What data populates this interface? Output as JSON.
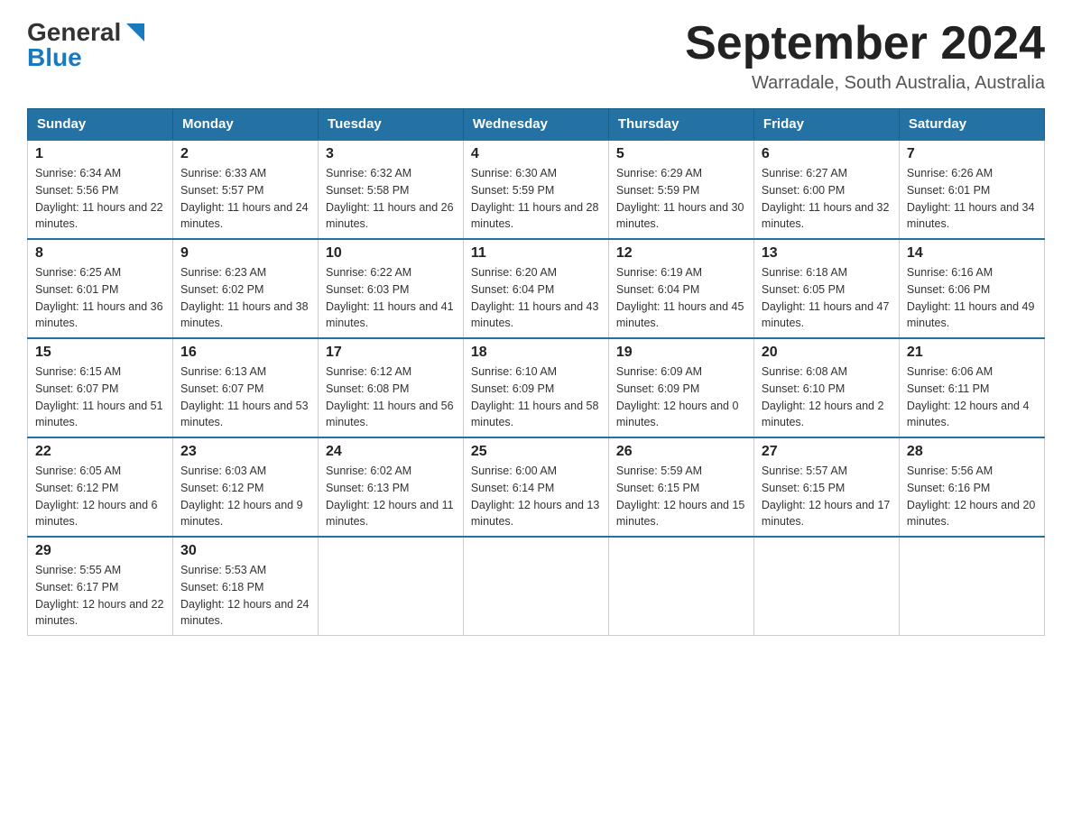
{
  "logo": {
    "general": "General",
    "blue": "Blue",
    "triangle_color": "#1a7abf"
  },
  "title": "September 2024",
  "subtitle": "Warradale, South Australia, Australia",
  "days_of_week": [
    "Sunday",
    "Monday",
    "Tuesday",
    "Wednesday",
    "Thursday",
    "Friday",
    "Saturday"
  ],
  "weeks": [
    [
      {
        "day": "1",
        "sunrise": "6:34 AM",
        "sunset": "5:56 PM",
        "daylight": "11 hours and 22 minutes."
      },
      {
        "day": "2",
        "sunrise": "6:33 AM",
        "sunset": "5:57 PM",
        "daylight": "11 hours and 24 minutes."
      },
      {
        "day": "3",
        "sunrise": "6:32 AM",
        "sunset": "5:58 PM",
        "daylight": "11 hours and 26 minutes."
      },
      {
        "day": "4",
        "sunrise": "6:30 AM",
        "sunset": "5:59 PM",
        "daylight": "11 hours and 28 minutes."
      },
      {
        "day": "5",
        "sunrise": "6:29 AM",
        "sunset": "5:59 PM",
        "daylight": "11 hours and 30 minutes."
      },
      {
        "day": "6",
        "sunrise": "6:27 AM",
        "sunset": "6:00 PM",
        "daylight": "11 hours and 32 minutes."
      },
      {
        "day": "7",
        "sunrise": "6:26 AM",
        "sunset": "6:01 PM",
        "daylight": "11 hours and 34 minutes."
      }
    ],
    [
      {
        "day": "8",
        "sunrise": "6:25 AM",
        "sunset": "6:01 PM",
        "daylight": "11 hours and 36 minutes."
      },
      {
        "day": "9",
        "sunrise": "6:23 AM",
        "sunset": "6:02 PM",
        "daylight": "11 hours and 38 minutes."
      },
      {
        "day": "10",
        "sunrise": "6:22 AM",
        "sunset": "6:03 PM",
        "daylight": "11 hours and 41 minutes."
      },
      {
        "day": "11",
        "sunrise": "6:20 AM",
        "sunset": "6:04 PM",
        "daylight": "11 hours and 43 minutes."
      },
      {
        "day": "12",
        "sunrise": "6:19 AM",
        "sunset": "6:04 PM",
        "daylight": "11 hours and 45 minutes."
      },
      {
        "day": "13",
        "sunrise": "6:18 AM",
        "sunset": "6:05 PM",
        "daylight": "11 hours and 47 minutes."
      },
      {
        "day": "14",
        "sunrise": "6:16 AM",
        "sunset": "6:06 PM",
        "daylight": "11 hours and 49 minutes."
      }
    ],
    [
      {
        "day": "15",
        "sunrise": "6:15 AM",
        "sunset": "6:07 PM",
        "daylight": "11 hours and 51 minutes."
      },
      {
        "day": "16",
        "sunrise": "6:13 AM",
        "sunset": "6:07 PM",
        "daylight": "11 hours and 53 minutes."
      },
      {
        "day": "17",
        "sunrise": "6:12 AM",
        "sunset": "6:08 PM",
        "daylight": "11 hours and 56 minutes."
      },
      {
        "day": "18",
        "sunrise": "6:10 AM",
        "sunset": "6:09 PM",
        "daylight": "11 hours and 58 minutes."
      },
      {
        "day": "19",
        "sunrise": "6:09 AM",
        "sunset": "6:09 PM",
        "daylight": "12 hours and 0 minutes."
      },
      {
        "day": "20",
        "sunrise": "6:08 AM",
        "sunset": "6:10 PM",
        "daylight": "12 hours and 2 minutes."
      },
      {
        "day": "21",
        "sunrise": "6:06 AM",
        "sunset": "6:11 PM",
        "daylight": "12 hours and 4 minutes."
      }
    ],
    [
      {
        "day": "22",
        "sunrise": "6:05 AM",
        "sunset": "6:12 PM",
        "daylight": "12 hours and 6 minutes."
      },
      {
        "day": "23",
        "sunrise": "6:03 AM",
        "sunset": "6:12 PM",
        "daylight": "12 hours and 9 minutes."
      },
      {
        "day": "24",
        "sunrise": "6:02 AM",
        "sunset": "6:13 PM",
        "daylight": "12 hours and 11 minutes."
      },
      {
        "day": "25",
        "sunrise": "6:00 AM",
        "sunset": "6:14 PM",
        "daylight": "12 hours and 13 minutes."
      },
      {
        "day": "26",
        "sunrise": "5:59 AM",
        "sunset": "6:15 PM",
        "daylight": "12 hours and 15 minutes."
      },
      {
        "day": "27",
        "sunrise": "5:57 AM",
        "sunset": "6:15 PM",
        "daylight": "12 hours and 17 minutes."
      },
      {
        "day": "28",
        "sunrise": "5:56 AM",
        "sunset": "6:16 PM",
        "daylight": "12 hours and 20 minutes."
      }
    ],
    [
      {
        "day": "29",
        "sunrise": "5:55 AM",
        "sunset": "6:17 PM",
        "daylight": "12 hours and 22 minutes."
      },
      {
        "day": "30",
        "sunrise": "5:53 AM",
        "sunset": "6:18 PM",
        "daylight": "12 hours and 24 minutes."
      },
      null,
      null,
      null,
      null,
      null
    ]
  ]
}
